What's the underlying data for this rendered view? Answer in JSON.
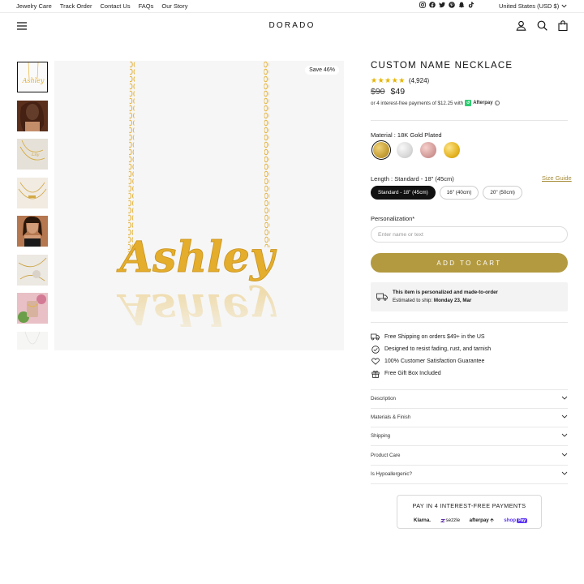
{
  "utility_bar": {
    "links": [
      "Jewelry Care",
      "Track Order",
      "Contact Us",
      "FAQs",
      "Our Story"
    ],
    "social_icons": [
      "instagram-icon",
      "facebook-icon",
      "twitter-icon",
      "pinterest-icon",
      "snapchat-icon",
      "tiktok-icon"
    ],
    "region": "United States (USD $)"
  },
  "header": {
    "logo": "DORADO",
    "icons": [
      "account-icon",
      "search-icon",
      "cart-icon"
    ]
  },
  "gallery": {
    "save_badge": "Save 46%",
    "main_image_text": "Ashley",
    "thumbnail_count": 8
  },
  "product": {
    "title": "CUSTOM NAME NECKLACE",
    "rating_count": "(4,924)",
    "original_price": "$90",
    "sale_price": "$49",
    "afterpay": {
      "text": "or 4 interest-free payments of $12.25 with",
      "brand": "Afterpay"
    },
    "material": {
      "label": "Material : 18K Gold Plated",
      "swatches": [
        {
          "name": "18K Gold Plated",
          "color": "#c9a33c",
          "selected": true
        },
        {
          "name": "Silver",
          "color": "#d9d9d9",
          "selected": false
        },
        {
          "name": "Rose Gold",
          "color": "#d39c9a",
          "selected": false
        },
        {
          "name": "Gold",
          "color": "#e4b422",
          "selected": false
        }
      ]
    },
    "length": {
      "label": "Length : Standard - 18\" (45cm)",
      "size_guide": "Size Guide",
      "options": [
        {
          "label": "Standard - 18\" (45cm)",
          "selected": true
        },
        {
          "label": "16\" (40cm)",
          "selected": false
        },
        {
          "label": "20\" (50cm)",
          "selected": false
        }
      ]
    },
    "personalization": {
      "label": "Personalization*",
      "placeholder": "Enter name or text"
    },
    "add_to_cart": "ADD TO CART",
    "notice": {
      "line1": "This item is personalized and made-to-order",
      "line2_prefix": "Estimated to ship:",
      "line2_date": "Monday 23, Mar"
    },
    "features": [
      {
        "icon": "truck-icon",
        "text": "Free Shipping on orders $49+ in the US"
      },
      {
        "icon": "check-circle-icon",
        "text": "Designed to resist fading, rust, and tarnish"
      },
      {
        "icon": "heart-icon",
        "text": "100% Customer Satisfaction Guarantee"
      },
      {
        "icon": "gift-icon",
        "text": "Free Gift Box Included"
      }
    ],
    "accordions": [
      "Description",
      "Materials & Finish",
      "Shipping",
      "Product Care",
      "Is Hypoallergenic?"
    ]
  },
  "payment_box": {
    "title": "PAY IN 4 INTEREST-FREE PAYMENTS",
    "providers": [
      "Klarna.",
      "sezzle",
      "afterpay",
      "shop",
      "Pay"
    ]
  },
  "colors": {
    "accent_gold": "#b39a40",
    "rating_star": "#e5b400",
    "chain_gold": "#e7b534"
  }
}
